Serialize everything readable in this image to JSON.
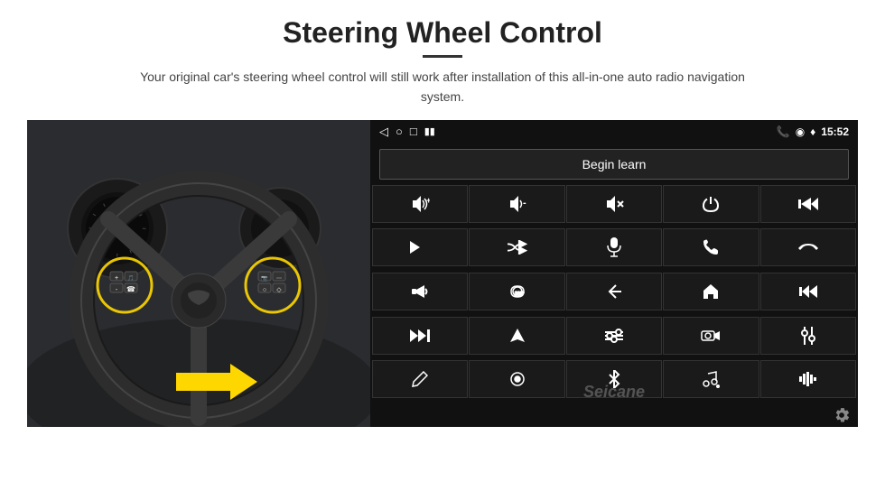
{
  "header": {
    "title": "Steering Wheel Control",
    "divider": true,
    "subtitle": "Your original car's steering wheel control will still work after installation of this all-in-one auto radio navigation system."
  },
  "status_bar": {
    "time": "15:52",
    "icons": [
      "back-arrow",
      "home-circle",
      "square",
      "signal-bars"
    ]
  },
  "begin_learn_button": {
    "label": "Begin learn"
  },
  "controls": [
    [
      "vol-up-icon",
      "vol-down-icon",
      "mute-icon",
      "power-icon",
      "prev-track-icon"
    ],
    [
      "skip-forward-icon",
      "shuffle-icon",
      "mic-icon",
      "phone-icon",
      "hang-up-icon"
    ],
    [
      "horn-icon",
      "camera360-icon",
      "back-icon",
      "home-icon",
      "prev-icon"
    ],
    [
      "next-fast-icon",
      "nav-icon",
      "eq-icon",
      "camera-icon",
      "equalizer-icon"
    ],
    [
      "pen-icon",
      "circle-dot-icon",
      "bluetooth-icon",
      "music-settings-icon",
      "bars-icon"
    ]
  ],
  "watermark": {
    "text": "Seicane"
  },
  "settings_icon": "gear-icon"
}
